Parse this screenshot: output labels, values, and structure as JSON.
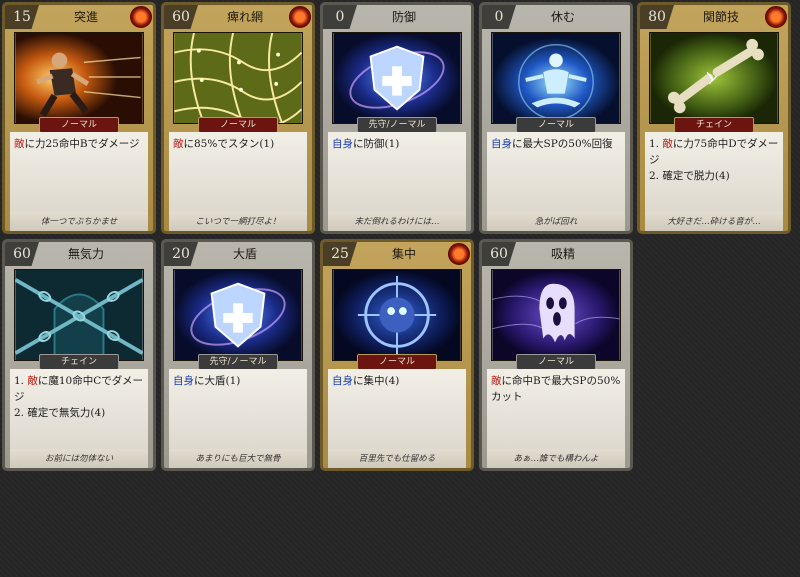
{
  "cards": [
    {
      "cost": "15",
      "title": "突進",
      "frame": "gold",
      "fire": true,
      "type": "ノーマル",
      "type_style": "red",
      "art": "dash",
      "desc": [
        [
          "red",
          "敵"
        ],
        [
          "",
          "に力25命中Bでダメージ"
        ]
      ],
      "flavor": "体一つでぶちかませ"
    },
    {
      "cost": "60",
      "title": "痺れ網",
      "frame": "gold",
      "fire": true,
      "type": "ノーマル",
      "type_style": "red",
      "art": "net",
      "desc": [
        [
          "red",
          "敵"
        ],
        [
          "",
          "に85%でスタン(1)"
        ]
      ],
      "flavor": "こいつで一網打尽よ！"
    },
    {
      "cost": "0",
      "title": "防御",
      "frame": "silver",
      "fire": false,
      "type": "先守/ノーマル",
      "type_style": "grey",
      "art": "shield",
      "desc": [
        [
          "blue",
          "自身"
        ],
        [
          "",
          "に防御(1)"
        ]
      ],
      "flavor": "未だ倒れるわけには…"
    },
    {
      "cost": "0",
      "title": "休む",
      "frame": "silver",
      "fire": false,
      "type": "ノーマル",
      "type_style": "grey",
      "art": "meditate",
      "desc": [
        [
          "blue",
          "自身"
        ],
        [
          "",
          "に最大SPの50%回復"
        ]
      ],
      "flavor": "急がば回れ"
    },
    {
      "cost": "80",
      "title": "関節技",
      "frame": "gold",
      "fire": true,
      "type": "チェイン",
      "type_style": "red",
      "art": "bone",
      "desc": [
        [
          "",
          "1. "
        ],
        [
          "red",
          "敵"
        ],
        [
          "",
          "に力75命中Dでダメージ"
        ],
        [
          "br",
          ""
        ],
        [
          "",
          "2. 確定で脱力(4)"
        ]
      ],
      "flavor": "大好きだ…砕ける音が…"
    },
    {
      "cost": "60",
      "title": "無気力",
      "frame": "silver",
      "fire": false,
      "type": "チェイン",
      "type_style": "grey",
      "art": "chains",
      "desc": [
        [
          "",
          "1. "
        ],
        [
          "red",
          "敵"
        ],
        [
          "",
          "に魔10命中Cでダメージ"
        ],
        [
          "br",
          ""
        ],
        [
          "",
          "2. 確定で無気力(4)"
        ]
      ],
      "flavor": "お前には勿体ない"
    },
    {
      "cost": "20",
      "title": "大盾",
      "frame": "silver",
      "fire": false,
      "type": "先守/ノーマル",
      "type_style": "grey",
      "art": "shield",
      "desc": [
        [
          "blue",
          "自身"
        ],
        [
          "",
          "に大盾(1)"
        ]
      ],
      "flavor": "あまりにも巨大で無骨"
    },
    {
      "cost": "25",
      "title": "集中",
      "frame": "gold",
      "fire": true,
      "type": "ノーマル",
      "type_style": "red",
      "art": "focus",
      "desc": [
        [
          "blue",
          "自身"
        ],
        [
          "",
          "に集中(4)"
        ]
      ],
      "flavor": "百里先でも仕留める"
    },
    {
      "cost": "60",
      "title": "吸精",
      "frame": "silver",
      "fire": false,
      "type": "ノーマル",
      "type_style": "grey",
      "art": "ghost",
      "desc": [
        [
          "red",
          "敵"
        ],
        [
          "",
          "に命中Bで最大SPの50%カット"
        ]
      ],
      "flavor": "あぁ…誰でも構わんよ"
    }
  ]
}
